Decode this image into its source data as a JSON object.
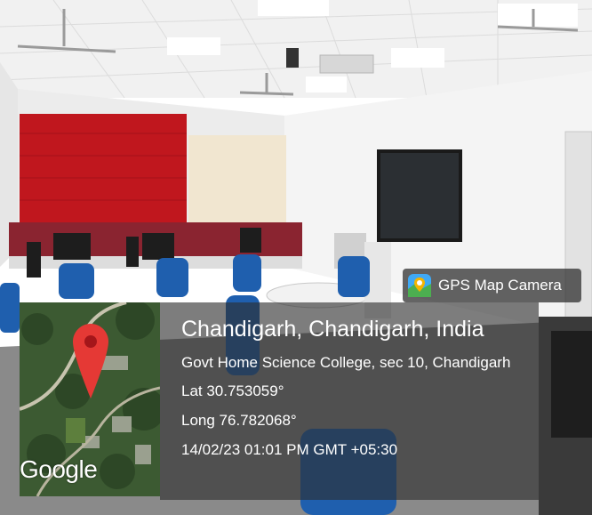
{
  "overlay": {
    "app_name": "GPS Map Camera",
    "app_icon": "gps-map-camera-app-icon",
    "place": "Chandigarh, Chandigarh, India",
    "address": "Govt Home Science College, sec 10, Chandigarh",
    "latitude": "Lat 30.753059°",
    "longitude": "Long 76.782068°",
    "datetime": "14/02/23 01:01 PM GMT +05:30",
    "map_attribution": "Google",
    "map_pin": "red-location-pin-icon"
  },
  "colors": {
    "panel_bg": "#2d2d2d",
    "pin": "#e53935",
    "blind_red": "#c0171e",
    "chair_blue": "#1f5fae"
  }
}
